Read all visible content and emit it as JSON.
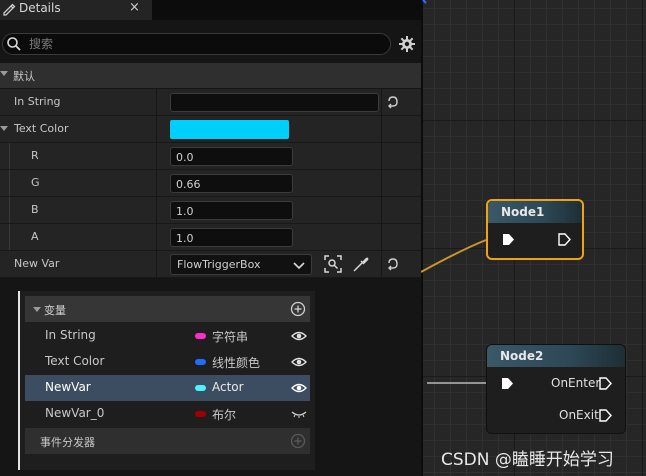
{
  "tab": {
    "title": "Details",
    "close": "×"
  },
  "search": {
    "placeholder": "搜索"
  },
  "section": {
    "label": "默认"
  },
  "properties": {
    "in_string": {
      "label": "In String",
      "value": ""
    },
    "text_color": {
      "label": "Text Color",
      "color": "#00cffb"
    },
    "r": {
      "label": "R",
      "value": "0.0"
    },
    "g": {
      "label": "G",
      "value": "0.66"
    },
    "b": {
      "label": "B",
      "value": "1.0"
    },
    "a": {
      "label": "A",
      "value": "1.0"
    },
    "new_var": {
      "label": "New Var",
      "value": "FlowTriggerBox"
    }
  },
  "variables": {
    "header": "变量",
    "items": [
      {
        "name": "In String",
        "type": "字符串",
        "color": "#ff2ccc"
      },
      {
        "name": "Text Color",
        "type": "线性颜色",
        "color": "#1a6fff"
      },
      {
        "name": "NewVar",
        "type": "Actor",
        "color": "#4ff0ff"
      },
      {
        "name": "NewVar_0",
        "type": "布尔",
        "color": "#a00000"
      }
    ],
    "dispatchers": "事件分发器"
  },
  "nodes": {
    "node1": {
      "title": "Node1"
    },
    "node2": {
      "title": "Node2",
      "on_enter": "OnEnter",
      "on_exit": "OnExit"
    }
  },
  "watermark": "CSDN @瞌睡开始学习",
  "colors": {
    "selected_row": "#3d4d61",
    "node_selection": "#f0a30e",
    "wire": "#c8962a"
  },
  "icons": [
    "pencil-icon",
    "close-icon",
    "search-icon",
    "gear-icon",
    "reset-arrow-icon",
    "chevron-down-icon",
    "browse-icon",
    "eyedropper-icon",
    "add-circle-icon",
    "eye-icon",
    "eye-closed-icon",
    "exec-pin-icon"
  ]
}
